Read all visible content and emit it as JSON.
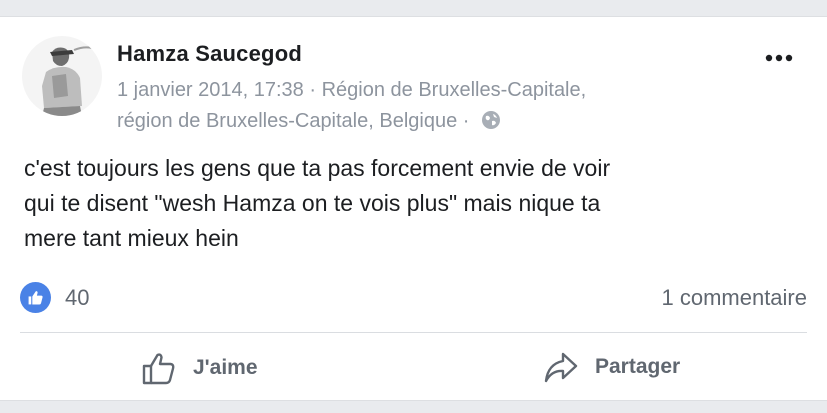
{
  "post": {
    "author": "Hamza Saucegod",
    "timestamp": "1 janvier 2014, 17:38",
    "location_line1": "Région de Bruxelles-Capitale,",
    "location_line2": "région de Bruxelles-Capitale, Belgique",
    "separator": " · ",
    "privacy_icon": "globe-icon",
    "more_icon": "more-options-icon",
    "text_lines": [
      "c'est toujours les gens que ta pas forcement envie de voir",
      "qui te disent \"wesh Hamza on te vois plus\" mais nique ta",
      "mere tant mieux hein"
    ]
  },
  "reactions": {
    "icon": "like-reaction-icon",
    "count": "40",
    "comments": "1 commentaire"
  },
  "actions": {
    "like_label": "J'aime",
    "like_icon": "thumbs-up-icon",
    "share_label": "Partager",
    "share_icon": "share-arrow-icon"
  },
  "colors": {
    "like_blue": "#4a82e6",
    "secondary_text": "#8d949e",
    "background": "#e9ebee"
  }
}
